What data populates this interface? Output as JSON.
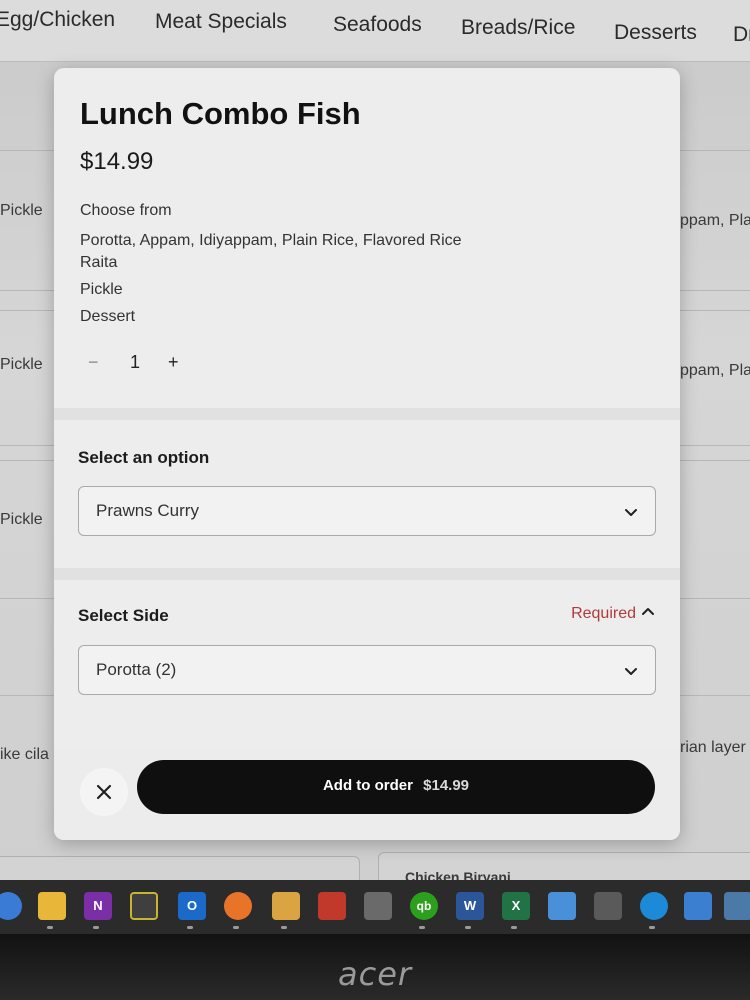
{
  "nav": {
    "items": [
      "Egg/Chicken",
      "Meat Specials",
      "Seafoods",
      "Breads/Rice",
      "Desserts",
      "Dr"
    ]
  },
  "background": {
    "left_snippets": [
      "Pickle",
      "Pickle",
      "Pickle",
      "ike cila"
    ],
    "right_snippets": [
      "ppam, Pla",
      "ppam, Pla",
      "rian layer"
    ],
    "bottom_card_title": "Chicken Biryani"
  },
  "modal": {
    "title": "Lunch Combo Fish",
    "price": "$14.99",
    "description": [
      "Choose from",
      "Porotta, Appam, Idiyappam, Plain Rice, Flavored Rice",
      "Raita",
      "Pickle",
      "Dessert"
    ],
    "quantity": {
      "minus": "−",
      "value": "1",
      "plus": "+"
    },
    "option_section": {
      "label": "Select an option",
      "selected": "Prawns Curry"
    },
    "side_section": {
      "label": "Select Side",
      "required": "Required",
      "selected": "Porotta (2)"
    },
    "footer": {
      "add_label": "Add to order",
      "add_price": "$14.99"
    }
  },
  "taskbar": {
    "icons": [
      "windows-start-icon",
      "file-explorer-icon",
      "onenote-icon",
      "xbox-icon",
      "outlook-icon",
      "firefox-icon",
      "package-icon",
      "fedex-icon",
      "printer-app-icon",
      "quickbooks-icon",
      "word-icon",
      "excel-icon",
      "notepad-icon",
      "calculator-icon",
      "edge-icon",
      "calendar-icon",
      "folder-window-icon"
    ]
  },
  "brand": "acer",
  "colors": {
    "accent_required": "#b23a3a",
    "button_bg": "#0f0f10"
  }
}
